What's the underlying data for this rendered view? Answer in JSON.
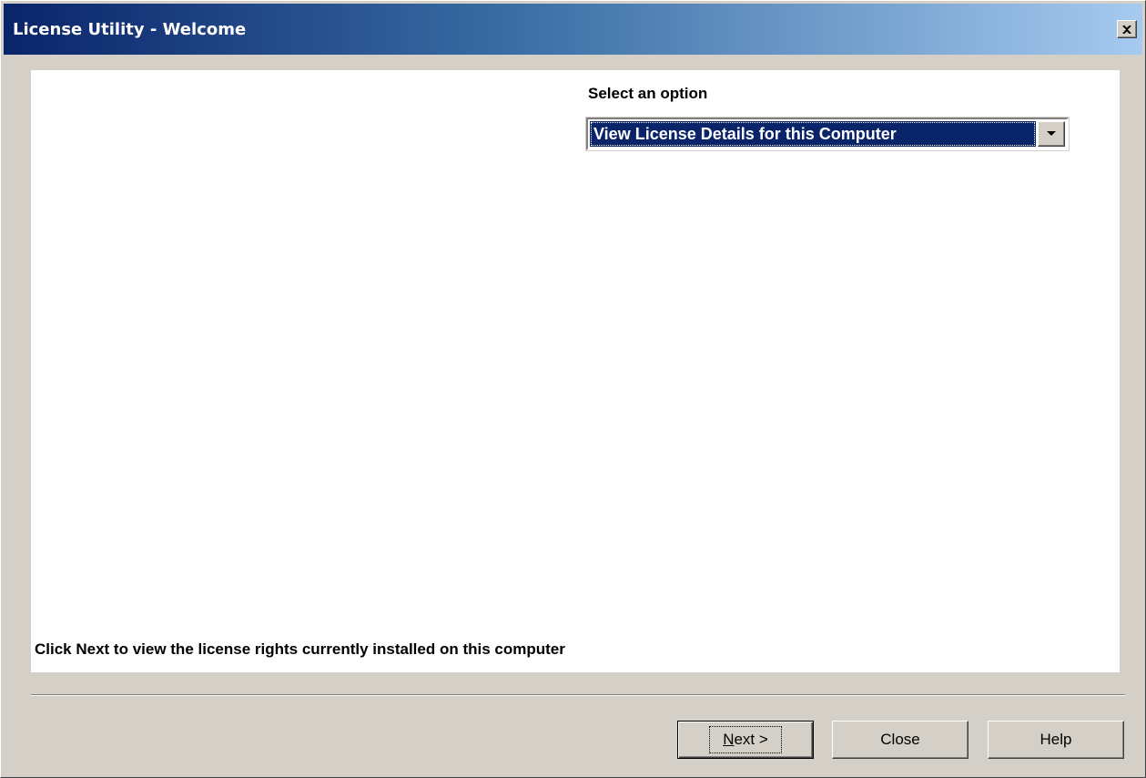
{
  "window": {
    "title": "License Utility - Welcome"
  },
  "icons": {
    "close": "close-icon",
    "dropdown": "chevron-down-icon"
  },
  "main": {
    "option_label": "Select an option",
    "option_selected": "View License Details for this Computer",
    "hint": "Click Next to view the license rights currently installed on this computer"
  },
  "buttons": {
    "next_mnemonic": "N",
    "next_rest": "ext >",
    "close": "Close",
    "help": "Help"
  },
  "colors": {
    "title_gradient_start": "#0a246a",
    "title_gradient_end": "#a6caf0",
    "selection": "#0a246a",
    "face": "#d4d0c8"
  }
}
